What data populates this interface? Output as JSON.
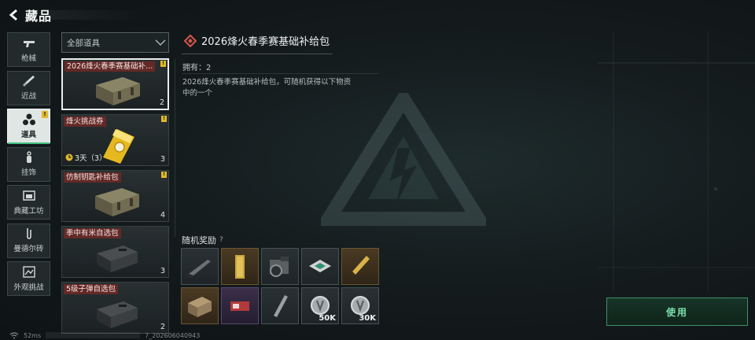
{
  "header": {
    "title": "藏品",
    "back_icon": "back-arrow-icon"
  },
  "nav": [
    {
      "label": "枪械",
      "icon": "gun-icon",
      "active": false,
      "badge": ""
    },
    {
      "label": "近战",
      "icon": "knife-icon",
      "active": false,
      "badge": ""
    },
    {
      "label": "道具",
      "icon": "items-icon",
      "active": true,
      "badge": "!"
    },
    {
      "label": "挂饰",
      "icon": "charm-icon",
      "active": false,
      "badge": ""
    },
    {
      "label": "典藏工坊",
      "icon": "workshop-icon",
      "active": false,
      "badge": ""
    },
    {
      "label": "曼德尔砖",
      "icon": "brick-icon",
      "active": false,
      "badge": ""
    },
    {
      "label": "外观挑战",
      "icon": "challenge-icon",
      "active": false,
      "badge": ""
    }
  ],
  "filter": {
    "label": "全部道具"
  },
  "items": [
    {
      "name": "2026烽火春季赛基础补...",
      "count": "2",
      "badge": "!",
      "selected": true,
      "image": "crate-icon"
    },
    {
      "name": "烽火挑战券",
      "count": "3",
      "badge": "!",
      "selected": false,
      "image": "ticket-icon",
      "timer": "3天（3）"
    },
    {
      "name": "仿制钥匙补给包",
      "count": "4",
      "badge": "!",
      "selected": false,
      "image": "crate-icon"
    },
    {
      "name": "季中有米自选包",
      "count": "3",
      "badge": "",
      "selected": false,
      "image": "case-icon"
    },
    {
      "name": "5级子弹自选包",
      "count": "2",
      "badge": "",
      "selected": false,
      "image": "case-icon"
    }
  ],
  "detail": {
    "title": "2026烽火春季赛基础补给包",
    "owned": "拥有：2",
    "description": "2026烽火春季赛基础补给包，可随机获得以下物资中的一个"
  },
  "rewards": {
    "title": "随机奖励",
    "help": "?",
    "items": [
      {
        "icon": "knife-icon",
        "rarity": "default",
        "amount": ""
      },
      {
        "icon": "gold-bar-icon",
        "rarity": "gold",
        "amount": ""
      },
      {
        "icon": "camera-icon",
        "rarity": "default",
        "amount": ""
      },
      {
        "icon": "chip-icon",
        "rarity": "default",
        "amount": ""
      },
      {
        "icon": "pen-icon",
        "rarity": "gold",
        "amount": ""
      },
      {
        "icon": "ammo-box-icon",
        "rarity": "gold",
        "amount": ""
      },
      {
        "icon": "card-icon",
        "rarity": "purple",
        "amount": ""
      },
      {
        "icon": "blade-icon",
        "rarity": "default",
        "amount": ""
      },
      {
        "icon": "coin-icon",
        "rarity": "default",
        "amount": "50K"
      },
      {
        "icon": "coin-icon",
        "rarity": "default",
        "amount": "30K"
      }
    ]
  },
  "use_button": {
    "label": "使用"
  },
  "status": {
    "ping": "52ms",
    "uid_suffix": "7_202606040943"
  },
  "colors": {
    "accent_green": "#3fbf7f",
    "badge_yellow": "#e0b92c",
    "name_red": "#782824"
  }
}
